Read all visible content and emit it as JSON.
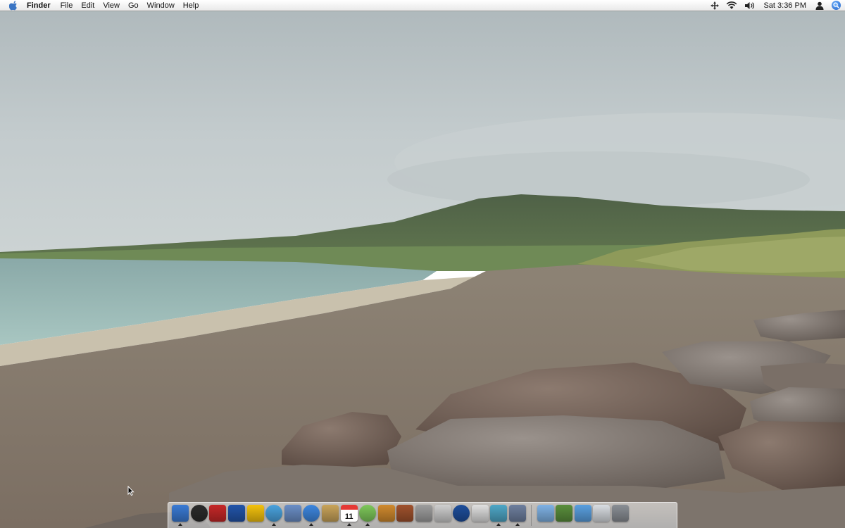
{
  "menubar": {
    "app_name": "Finder",
    "menus": [
      "File",
      "Edit",
      "View",
      "Go",
      "Window",
      "Help"
    ],
    "clock": "Sat 3:36 PM",
    "status_icons": [
      "spaces-icon",
      "wifi-icon",
      "volume-icon",
      "user-icon",
      "spotlight-icon"
    ]
  },
  "dock": {
    "apps": [
      {
        "name": "finder-icon",
        "color": "#3a7bd5",
        "running": true
      },
      {
        "name": "dashboard-icon",
        "color": "#2b2b2b",
        "running": false,
        "round": true
      },
      {
        "name": "front-row-icon",
        "color": "#c62828",
        "running": false
      },
      {
        "name": "mail-icon",
        "color": "#2255aa",
        "running": false
      },
      {
        "name": "console-icon",
        "color": "#f4c20d",
        "running": false
      },
      {
        "name": "safari-icon",
        "color": "#4aa3df",
        "running": true,
        "round": true
      },
      {
        "name": "preview-icon",
        "color": "#6b8fc7",
        "running": false
      },
      {
        "name": "ichat-icon",
        "color": "#3d87e0",
        "running": true,
        "round": true
      },
      {
        "name": "address-book-icon",
        "color": "#c9a45a",
        "running": false
      },
      {
        "name": "ical-icon",
        "color": "#e53935",
        "label": "11",
        "running": true
      },
      {
        "name": "itunes-icon",
        "color": "#7ec85a",
        "running": true,
        "round": true
      },
      {
        "name": "iphoto-icon",
        "color": "#d08a2e",
        "running": false
      },
      {
        "name": "photo-booth-icon",
        "color": "#a0522d",
        "running": false
      },
      {
        "name": "system-preferences-icon",
        "color": "#9e9e9e",
        "running": false
      },
      {
        "name": "dvd-player-icon",
        "color": "#cfcfcf",
        "running": false
      },
      {
        "name": "google-earth-icon",
        "color": "#1e4f9c",
        "running": false,
        "round": true
      },
      {
        "name": "apple-store-icon",
        "color": "#e0e0e0",
        "running": false
      },
      {
        "name": "screenshot-icon",
        "color": "#4ea7c7",
        "running": true
      },
      {
        "name": "grab-icon",
        "color": "#6e7f9e",
        "running": true
      }
    ],
    "stacks": [
      {
        "name": "applications-folder-icon",
        "color": "#7fb2e5"
      },
      {
        "name": "bonsai-app-icon",
        "color": "#5a8f3c"
      },
      {
        "name": "desktop-folder-icon",
        "color": "#5aa0e0"
      },
      {
        "name": "documents-stack-icon",
        "color": "#d9dde2"
      },
      {
        "name": "trash-icon",
        "color": "#8a8f95"
      }
    ]
  }
}
